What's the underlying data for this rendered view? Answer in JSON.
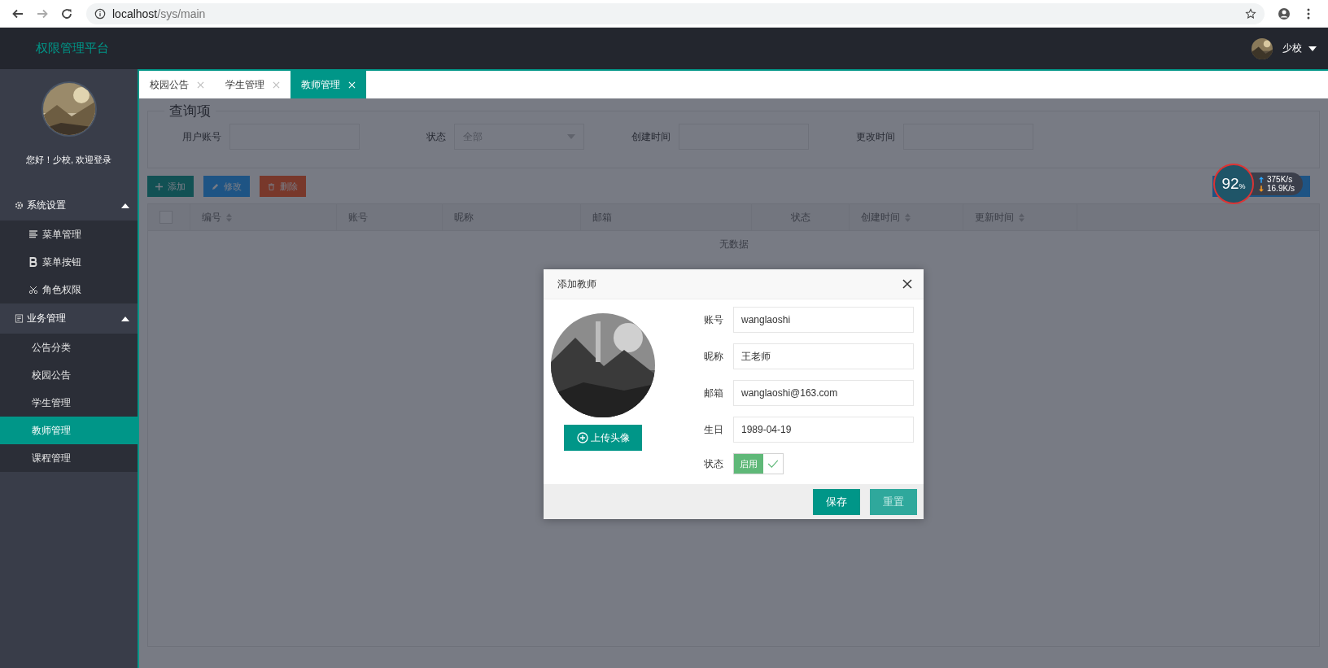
{
  "browser": {
    "url_host": "localhost",
    "url_path": "/sys/main"
  },
  "header": {
    "title": "权限管理平台",
    "user": "少校"
  },
  "sidebar": {
    "greeting": "您好！少校, 欢迎登录",
    "groups": [
      {
        "label": "系统设置",
        "kind": "gear",
        "expanded": true,
        "items": [
          {
            "label": "菜单管理",
            "kind": "lines",
            "selected": false
          },
          {
            "label": "菜单按钮",
            "kind": "letter",
            "selected": false
          },
          {
            "label": "角色权限",
            "kind": "scissors",
            "selected": false
          }
        ]
      },
      {
        "label": "业务管理",
        "kind": "doc",
        "expanded": true,
        "items": [
          {
            "label": "公告分类",
            "kind": "plain",
            "selected": false
          },
          {
            "label": "校园公告",
            "kind": "plain",
            "selected": false
          },
          {
            "label": "学生管理",
            "kind": "plain",
            "selected": false
          },
          {
            "label": "教师管理",
            "kind": "plain",
            "selected": true
          },
          {
            "label": "课程管理",
            "kind": "plain",
            "selected": false
          }
        ]
      }
    ]
  },
  "tabs": [
    {
      "label": "校园公告",
      "selected": false
    },
    {
      "label": "学生管理",
      "selected": false
    },
    {
      "label": "教师管理",
      "selected": true
    }
  ],
  "query": {
    "legend": "查询项",
    "fields": [
      {
        "label": "用户账号",
        "kind": "input"
      },
      {
        "label": "状态",
        "kind": "select",
        "value": "全部"
      },
      {
        "label": "创建时间",
        "kind": "input"
      },
      {
        "label": "更改时间",
        "kind": "input"
      }
    ]
  },
  "toolbar": [
    {
      "label": "添加",
      "kind": "add"
    },
    {
      "label": "修改",
      "kind": "edit"
    },
    {
      "label": "删除",
      "kind": "delete"
    }
  ],
  "table": {
    "select_all": {
      "checked": false
    },
    "columns": [
      {
        "label": "编号",
        "sortable": true
      },
      {
        "label": "账号",
        "sortable": false
      },
      {
        "label": "昵称",
        "sortable": false
      },
      {
        "label": "邮箱",
        "sortable": false
      },
      {
        "label": "状态",
        "sortable": false
      },
      {
        "label": "创建时间",
        "sortable": true
      },
      {
        "label": "更新时间",
        "sortable": true
      }
    ],
    "empty_text": "无数据"
  },
  "speed_widget": {
    "percent": "92",
    "percent_unit": "%",
    "upload": "375K/s",
    "download": "16.9K/s"
  },
  "dialog": {
    "title": "添加教师",
    "upload_button": "上传头像",
    "fields": [
      {
        "label": "账号",
        "value": "wanglaoshi"
      },
      {
        "label": "昵称",
        "value": "王老师"
      },
      {
        "label": "邮箱",
        "value": "wanglaoshi@163.com"
      },
      {
        "label": "生日",
        "value": "1989-04-19"
      }
    ],
    "status": {
      "label": "状态",
      "text": "启用",
      "checked": true
    },
    "buttons": [
      {
        "label": "保存",
        "disabled": false
      },
      {
        "label": "重置",
        "disabled": true
      }
    ]
  }
}
